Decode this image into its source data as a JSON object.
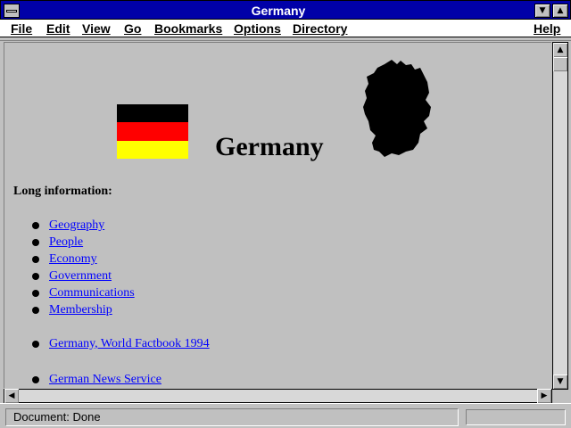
{
  "window": {
    "title": "Germany",
    "minimize_glyph": "▼",
    "maximize_glyph": "▲"
  },
  "menu": [
    {
      "label": "File"
    },
    {
      "label": "Edit"
    },
    {
      "label": "View"
    },
    {
      "label": "Go"
    },
    {
      "label": "Bookmarks"
    },
    {
      "label": "Options"
    },
    {
      "label": "Directory"
    },
    {
      "label": "Help"
    }
  ],
  "page": {
    "heading": "Germany",
    "long_info_label": "Long information:",
    "links": [
      "Geography",
      "People",
      "Economy",
      "Government",
      "Communications",
      "Membership",
      "Germany, World Factbook 1994",
      "German News Service"
    ],
    "flag_colors": [
      "#000000",
      "#ff0000",
      "#ffff00"
    ]
  },
  "status": {
    "text": "Document: Done"
  }
}
